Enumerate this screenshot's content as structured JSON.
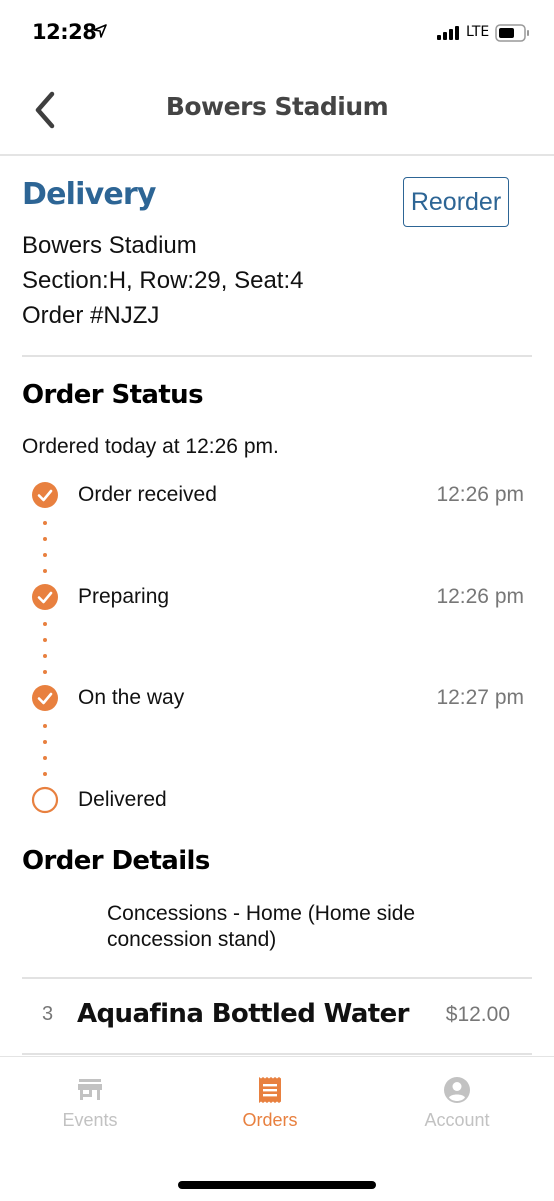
{
  "status_bar": {
    "time": "12:28",
    "network": "LTE",
    "icons": [
      "location-arrow-icon",
      "signal-icon",
      "battery-icon"
    ]
  },
  "nav": {
    "title": "Bowers Stadium",
    "back_icon": "chevron-left-icon"
  },
  "delivery": {
    "title": "Delivery",
    "reorder_label": "Reorder",
    "venue": "Bowers Stadium",
    "seat": "Section:H, Row:29, Seat:4",
    "order_number": "Order #NJZJ"
  },
  "order_status": {
    "title": "Order Status",
    "ordered_text": "Ordered today at 12:26 pm.",
    "steps": [
      {
        "label": "Order received",
        "time": "12:26 pm",
        "completed": true
      },
      {
        "label": "Preparing",
        "time": "12:26 pm",
        "completed": true
      },
      {
        "label": "On the way",
        "time": "12:27 pm",
        "completed": true
      },
      {
        "label": "Delivered",
        "time": "",
        "completed": false
      }
    ]
  },
  "order_details": {
    "title": "Order Details",
    "stand": "Concessions - Home (Home side concession stand)",
    "items": [
      {
        "qty": "3",
        "name": "Aquafina Bottled Water",
        "price": "$12.00"
      }
    ]
  },
  "tab_bar": {
    "tabs": [
      {
        "label": "Events",
        "icon": "storefront-icon",
        "active": false
      },
      {
        "label": "Orders",
        "icon": "receipt-icon",
        "active": true
      },
      {
        "label": "Account",
        "icon": "account-circle-icon",
        "active": false
      }
    ]
  },
  "colors": {
    "accent": "#e8803f",
    "brand_blue": "#2d6595",
    "inactive_tab": "#c2c2c2"
  }
}
